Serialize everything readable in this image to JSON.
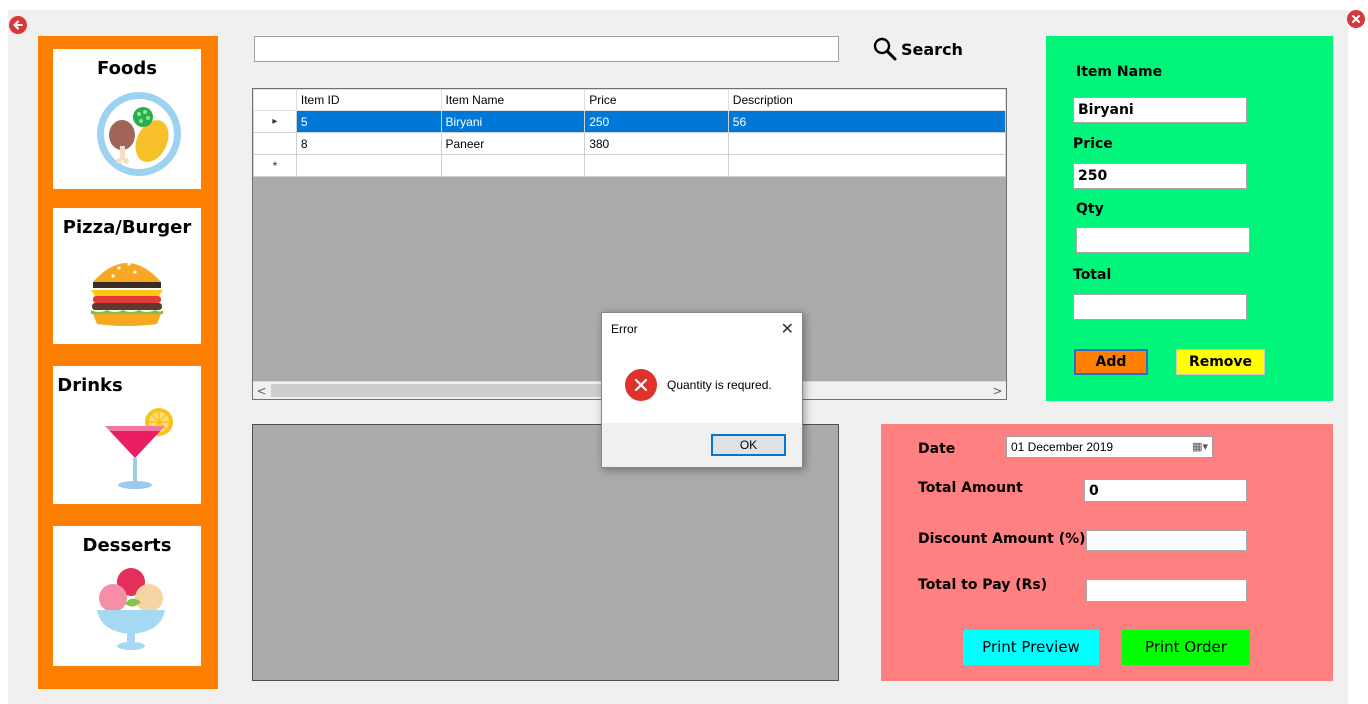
{
  "sidebar": {
    "categories": [
      {
        "label": "Foods"
      },
      {
        "label": "Pizza/Burger"
      },
      {
        "label": "Drinks"
      },
      {
        "label": "Desserts"
      }
    ]
  },
  "search": {
    "value": "",
    "button_label": "Search"
  },
  "grid": {
    "columns": [
      "Item ID",
      "Item Name",
      "Price",
      "Description"
    ],
    "rows": [
      {
        "marker": "▸",
        "item_id": "5",
        "item_name": "Biryani",
        "price": "250",
        "description": "56"
      },
      {
        "marker": "",
        "item_id": "8",
        "item_name": "Paneer",
        "price": "380",
        "description": ""
      },
      {
        "marker": "*",
        "item_id": "",
        "item_name": "",
        "price": "",
        "description": ""
      }
    ],
    "scroll_left": "<",
    "scroll_right": ">"
  },
  "item_panel": {
    "item_name_label": "Item Name",
    "item_name_value": "Biryani",
    "price_label": "Price",
    "price_value": "250",
    "qty_label": "Qty",
    "qty_value": "",
    "total_label": "Total",
    "total_value": "",
    "add_label": "Add",
    "remove_label": "Remove"
  },
  "order_panel": {
    "date_label": "Date",
    "date_value": "01 December 2019",
    "total_amount_label": "Total Amount",
    "total_amount_value": "0",
    "discount_label": "Discount Amount (%)",
    "discount_value": "",
    "total_to_pay_label": "Total to Pay (Rs)",
    "total_to_pay_value": "",
    "print_preview_label": "Print Preview",
    "print_order_label": "Print Order"
  },
  "dialog": {
    "title": "Error",
    "message": "Quantity is requred.",
    "ok_label": "OK"
  },
  "colors": {
    "sidebar": "#ff8000",
    "item_panel": "#00f57a",
    "order_panel": "#ff8080",
    "selected_row": "#0078d7",
    "error_icon": "#e0312c"
  }
}
